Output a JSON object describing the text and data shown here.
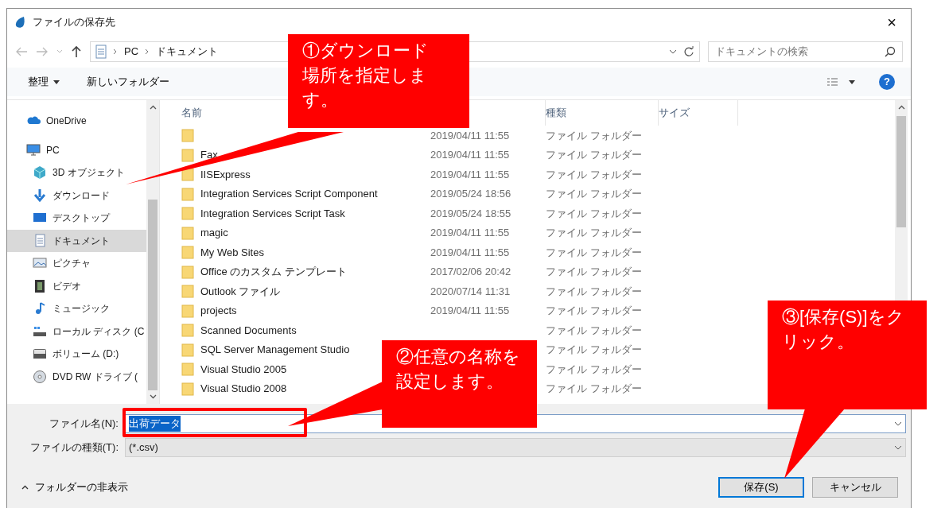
{
  "window": {
    "title": "ファイルの保存先",
    "close": "×"
  },
  "address": {
    "path": [
      "PC",
      "ドキュメント"
    ],
    "search_placeholder": "ドキュメントの検索"
  },
  "toolbar": {
    "organize": "整理",
    "new_folder": "新しいフォルダー",
    "help": "?"
  },
  "sidebar": {
    "items": [
      {
        "label": "OneDrive",
        "selected": false
      },
      {
        "label": "PC",
        "selected": false,
        "children": [
          {
            "label": "3D オブジェクト",
            "selected": false
          },
          {
            "label": "ダウンロード",
            "selected": false
          },
          {
            "label": "デスクトップ",
            "selected": false
          },
          {
            "label": "ドキュメント",
            "selected": true
          },
          {
            "label": "ピクチャ",
            "selected": false
          },
          {
            "label": "ビデオ",
            "selected": false
          },
          {
            "label": "ミュージック",
            "selected": false
          },
          {
            "label": "ローカル ディスク (C",
            "selected": false
          },
          {
            "label": "ボリューム (D:)",
            "selected": false
          },
          {
            "label": "DVD RW ドライブ (",
            "selected": false
          }
        ]
      }
    ]
  },
  "columns": {
    "name": "名前",
    "type": "種類",
    "size": "サイズ"
  },
  "files": [
    {
      "modified": "2019/04/11 11:55",
      "type": "ファイル フォルダー"
    },
    {
      "name": "Fax",
      "modified": "2019/04/11 11:55",
      "type": "ファイル フォルダー"
    },
    {
      "name": "IISExpress",
      "modified": "2019/04/11 11:55",
      "type": "ファイル フォルダー"
    },
    {
      "name": "Integration Services Script Component",
      "modified": "2019/05/24 18:56",
      "type": "ファイル フォルダー"
    },
    {
      "name": "Integration Services Script Task",
      "modified": "2019/05/24 18:55",
      "type": "ファイル フォルダー"
    },
    {
      "name": "magic",
      "modified": "2019/04/11 11:55",
      "type": "ファイル フォルダー"
    },
    {
      "name": "My Web Sites",
      "modified": "2019/04/11 11:55",
      "type": "ファイル フォルダー"
    },
    {
      "name": "Office のカスタム テンプレート",
      "modified": "2017/02/06 20:42",
      "type": "ファイル フォルダー"
    },
    {
      "name": "Outlook ファイル",
      "modified": "2020/07/14 11:31",
      "type": "ファイル フォルダー"
    },
    {
      "name": "projects",
      "modified": "2019/04/11 11:55",
      "type": "ファイル フォルダー"
    },
    {
      "name": "Scanned Documents",
      "type": "ファイル フォルダー"
    },
    {
      "name": "SQL Server Management Studio",
      "type": "ファイル フォルダー"
    },
    {
      "name": "Visual Studio 2005",
      "type": "ファイル フォルダー"
    },
    {
      "name": "Visual Studio 2008",
      "type": "ファイル フォルダー"
    }
  ],
  "filename": {
    "label": "ファイル名(N):",
    "value": "出荷データ",
    "text_selected": true,
    "highlighted": true
  },
  "filetype": {
    "label": "ファイルの種類(T):",
    "value": "(*.csv)"
  },
  "hide_folders": "フォルダーの非表示",
  "buttons": [
    {
      "label": "保存(S)",
      "default": true
    },
    {
      "label": "キャンセル",
      "default": false
    }
  ],
  "callouts": [
    {
      "text": "①ダウンロード場所を指定します。"
    },
    {
      "text": "②任意の名称を設定します。"
    },
    {
      "text": "③[保存(S)]をクリック。"
    }
  ]
}
